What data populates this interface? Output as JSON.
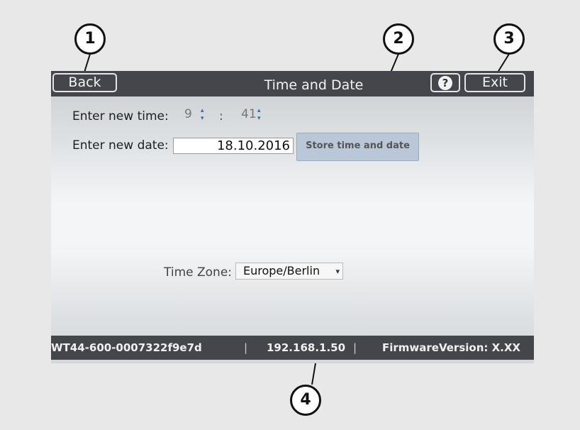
{
  "window": {
    "title": "Time and Date"
  },
  "toolbar": {
    "back_label": "Back",
    "exit_label": "Exit",
    "help_label": "?"
  },
  "time": {
    "label": "Enter new time:",
    "hour": "9",
    "separator": ":",
    "minute": "41"
  },
  "date": {
    "label": "Enter new date:",
    "value": "18.10.2016"
  },
  "store_button": {
    "label": "Store time and date"
  },
  "timezone": {
    "label": "Time Zone:",
    "value": "Europe/Berlin"
  },
  "status": {
    "device_id": "WT44-600-0007322f9e7d",
    "separator": "|",
    "ip": "192.168.1.50",
    "firmware": "FirmwareVersion: X.XX"
  },
  "callouts": [
    "1",
    "2",
    "3",
    "4"
  ],
  "colors": {
    "bar": "#44464b",
    "store_button": "#b9c7d8",
    "spinner_arrow": "#2d6bb3"
  }
}
